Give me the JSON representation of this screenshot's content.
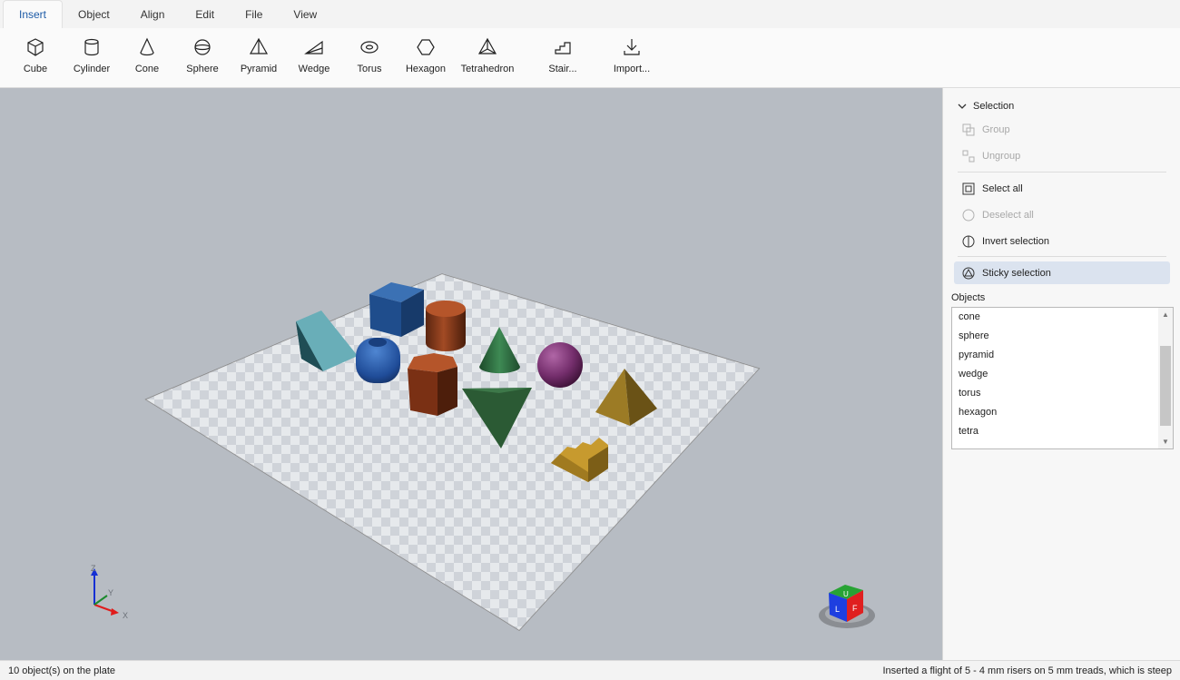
{
  "menu": {
    "tabs": [
      "Insert",
      "Object",
      "Align",
      "Edit",
      "File",
      "View"
    ],
    "active": "Insert"
  },
  "ribbon": {
    "tools": [
      {
        "label": "Cube",
        "icon": "cube-icon"
      },
      {
        "label": "Cylinder",
        "icon": "cylinder-icon"
      },
      {
        "label": "Cone",
        "icon": "cone-icon"
      },
      {
        "label": "Sphere",
        "icon": "sphere-icon"
      },
      {
        "label": "Pyramid",
        "icon": "pyramid-icon"
      },
      {
        "label": "Wedge",
        "icon": "wedge-icon"
      },
      {
        "label": "Torus",
        "icon": "torus-icon"
      },
      {
        "label": "Hexagon",
        "icon": "hexagon-icon"
      },
      {
        "label": "Tetrahedron",
        "icon": "tetrahedron-icon"
      },
      {
        "label": "Stair...",
        "icon": "stair-icon"
      },
      {
        "label": "Import...",
        "icon": "import-icon"
      }
    ]
  },
  "panel": {
    "selection_header": "Selection",
    "group": "Group",
    "ungroup": "Ungroup",
    "select_all": "Select all",
    "deselect_all": "Deselect all",
    "invert_selection": "Invert selection",
    "sticky_selection": "Sticky selection",
    "objects_title": "Objects",
    "objects": [
      "cone",
      "sphere",
      "pyramid",
      "wedge",
      "torus",
      "hexagon",
      "tetra"
    ]
  },
  "viewport": {
    "axis_labels": {
      "z": "Z",
      "y": "Y",
      "x": "X"
    },
    "view_cube_faces": {
      "top": "U",
      "left": "L",
      "front": "F"
    }
  },
  "status": {
    "left": "10 object(s) on the plate",
    "right": "Inserted a flight of 5 - 4 mm risers on 5 mm treads, which is steep"
  },
  "colors": {
    "accent": "#1c5aa6",
    "viewport_bg": "#b7bcc3",
    "sticky_bg": "#dbe3ef"
  }
}
